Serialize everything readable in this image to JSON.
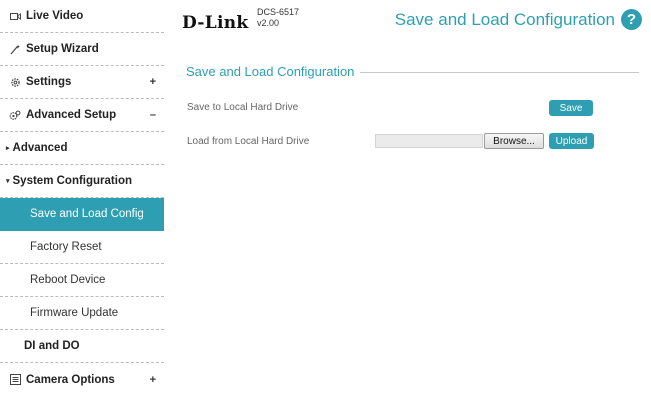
{
  "header": {
    "logo": "D-Link",
    "model": "DCS-6517",
    "version": "v2.00",
    "page_title": "Save and Load Configuration",
    "help_glyph": "?"
  },
  "sidebar": {
    "items": [
      {
        "label": "Live Video",
        "icon": "video-icon"
      },
      {
        "label": "Setup Wizard",
        "icon": "wand-icon"
      },
      {
        "label": "Settings",
        "icon": "gear-icon",
        "toggle": "+"
      },
      {
        "label": "Advanced Setup",
        "icon": "gears-icon",
        "toggle": "–"
      },
      {
        "label": "Advanced",
        "caret": "▸"
      },
      {
        "label": "System Configuration",
        "caret": "▾"
      },
      {
        "label": "Save and Load Config",
        "active": true
      },
      {
        "label": "Factory Reset"
      },
      {
        "label": "Reboot Device"
      },
      {
        "label": "Firmware Update"
      },
      {
        "label": "DI and DO"
      },
      {
        "label": "Camera Options",
        "icon": "list-icon",
        "toggle": "+"
      }
    ]
  },
  "main": {
    "section_title": "Save and Load Configuration",
    "save_row": {
      "label": "Save to Local Hard Drive",
      "button": "Save"
    },
    "load_row": {
      "label": "Load from Local Hard Drive",
      "browse": "Browse...",
      "button": "Upload"
    }
  },
  "colors": {
    "accent": "#2e9fb3"
  }
}
